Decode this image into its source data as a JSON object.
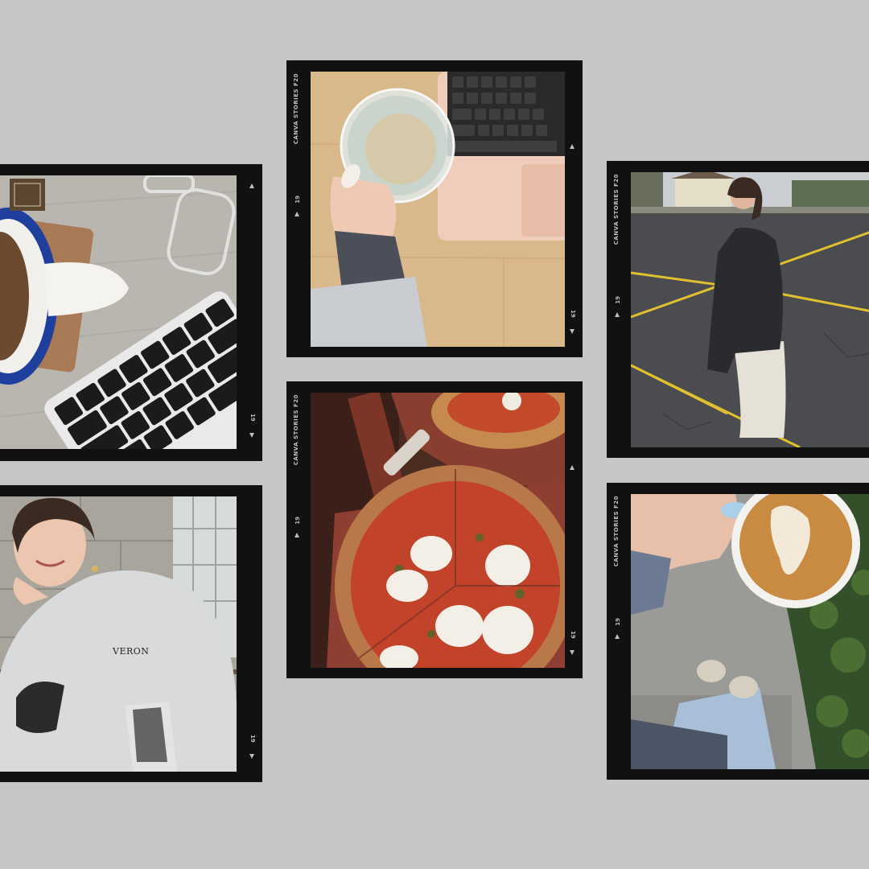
{
  "background_color": "#c6c6c6",
  "film_label": "CANVA STORIES F20",
  "frame_number": "19",
  "sweater_text": "VERON",
  "frames": [
    {
      "name": "keyboard-mug-photo",
      "subject": "blue-rimmed mug, glasses and keyboard on grey wood desk"
    },
    {
      "name": "water-glass-laptop-photo",
      "subject": "hand holding glass of water next to pink laptop"
    },
    {
      "name": "parking-lot-portrait-photo",
      "subject": "woman in black jacket standing in parking lot"
    },
    {
      "name": "sweatshirt-portrait-photo",
      "subject": "smiling woman in grey varsity sweatshirt"
    },
    {
      "name": "pizza-photo",
      "subject": "margherita pizza on wooden peel"
    },
    {
      "name": "latte-photo",
      "subject": "hand holding latte above feet on sidewalk"
    }
  ]
}
